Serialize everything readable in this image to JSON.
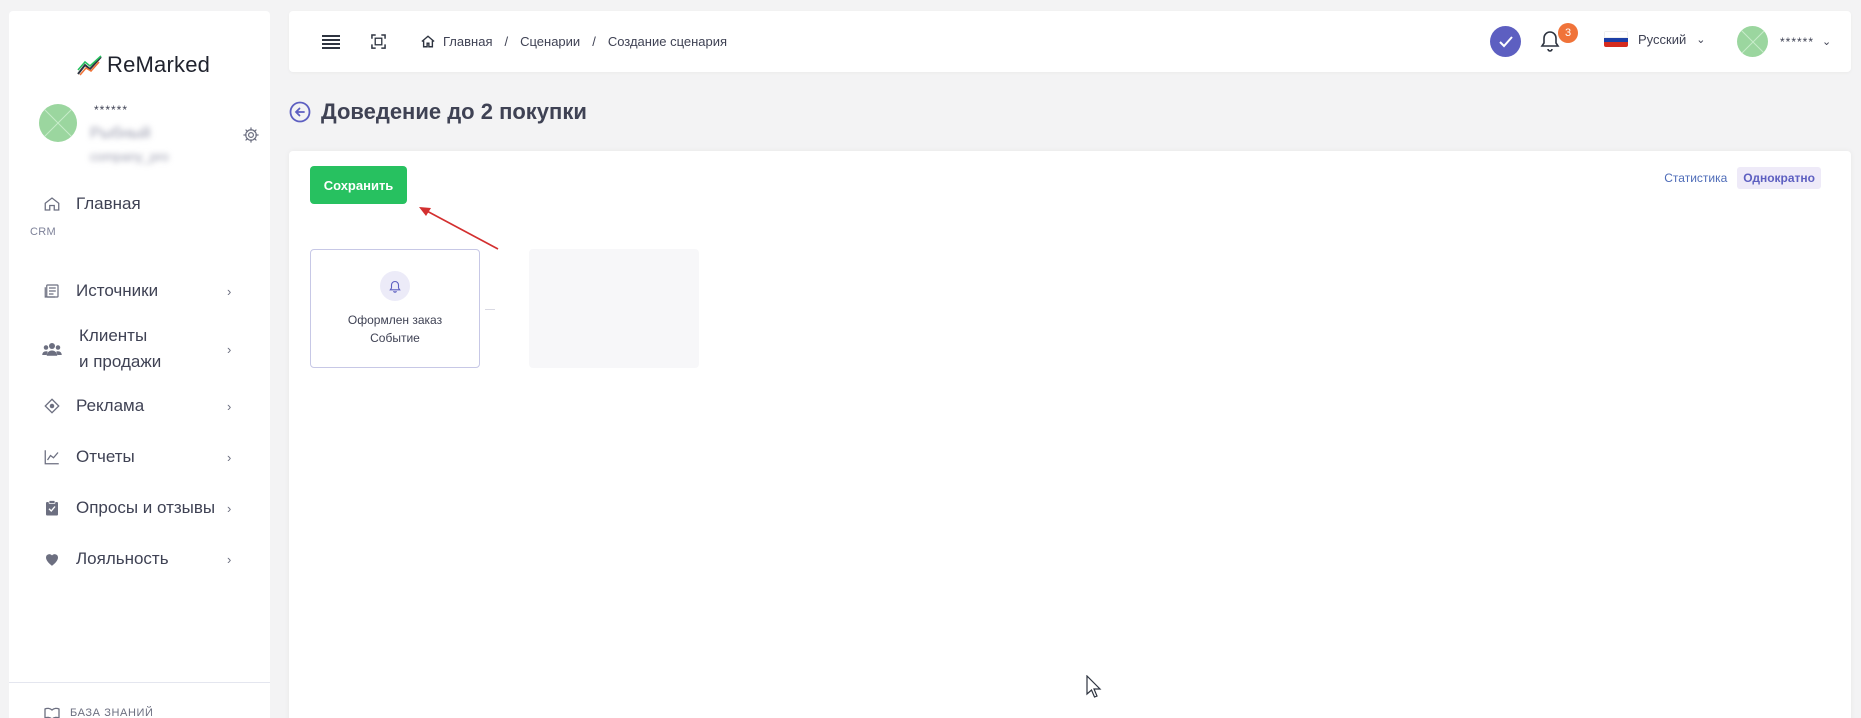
{
  "app": {
    "logo_text": "ReMarked"
  },
  "profile": {
    "stars": "******",
    "name": "Рыбный",
    "login": "company_pro"
  },
  "sidebar": {
    "items": [
      {
        "label": "Главная",
        "icon": "home-icon"
      },
      {
        "label": "Источники",
        "icon": "sources-icon"
      },
      {
        "label_line1": "Клиенты",
        "label_line2": "и продажи",
        "icon": "users-icon"
      },
      {
        "label": "Реклама",
        "icon": "target-icon"
      },
      {
        "label": "Отчеты",
        "icon": "chart-icon"
      },
      {
        "label": "Опросы и отзывы",
        "icon": "clipboard-icon"
      },
      {
        "label": "Лояльность",
        "icon": "heart-icon"
      }
    ],
    "section_crm": "CRM",
    "knowledge_base": "БАЗА ЗНАНИЙ"
  },
  "header": {
    "breadcrumb": [
      "Главная",
      "Сценарии",
      "Создание сценария"
    ],
    "notifications_count": "3",
    "language": "Русский",
    "user_stars": "******"
  },
  "page": {
    "title": "Доведение до 2 покупки"
  },
  "card": {
    "save_label": "Сохранить",
    "stats_label": "Статистика",
    "once_label": "Однократно",
    "node": {
      "title": "Оформлен заказ",
      "subtitle": "Событие"
    }
  },
  "colors": {
    "accent": "#5d5fc1",
    "save": "#27c160",
    "badge": "#f07339",
    "annotation": "#d32f2f"
  }
}
